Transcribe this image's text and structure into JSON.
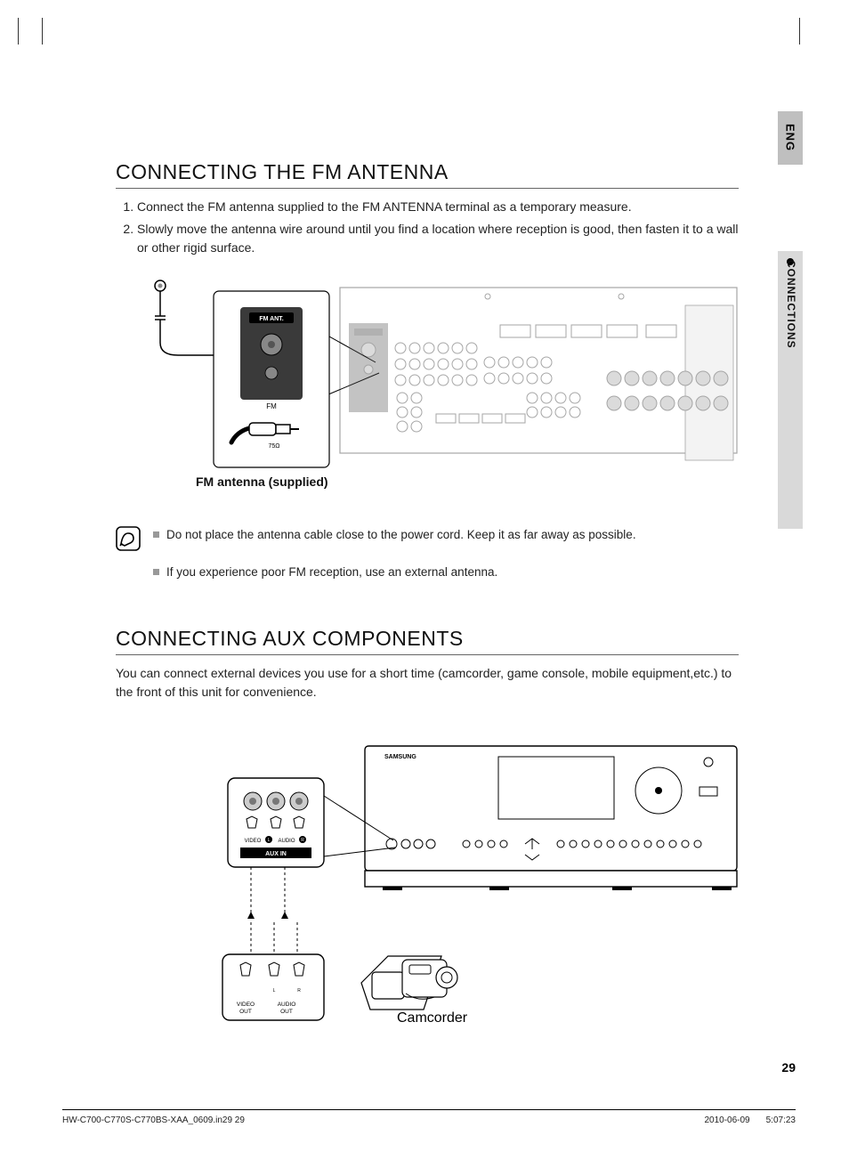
{
  "lang_tab": "ENG",
  "section_tab": "CONNECTIONS",
  "section1": {
    "title": "CONNECTING THE FM ANTENNA",
    "steps": [
      "Connect the FM antenna supplied to the FM ANTENNA terminal as a temporary measure.",
      "Slowly move the antenna wire around until you find a location where reception is good, then fasten it to a wall or other rigid surface."
    ],
    "fig_caption": "FM antenna (supplied)",
    "fig_label_fmant": "FM ANT.",
    "fig_label_fm": "FM",
    "fig_label_ohm": "75Ω",
    "notes": [
      "Do not place the antenna cable close to the power cord. Keep it as far away as possible.",
      "If you experience poor FM reception, use an external antenna."
    ]
  },
  "section2": {
    "title": "CONNECTING AUX COMPONENTS",
    "intro": "You can connect external devices you use for a short time (camcorder, game console, mobile equipment,etc.) to the front of this unit for convenience.",
    "fig_brand": "SAMSUNG",
    "fig_video": "VIDEO",
    "fig_audio": "AUDIO",
    "fig_auxin": "AUX IN",
    "fig_videoout": "VIDEO\nOUT",
    "fig_audioout": "AUDIO\nOUT",
    "fig_l": "L",
    "fig_r": "R",
    "fig_camcorder": "Camcorder"
  },
  "page_number": "29",
  "footer": {
    "left": "HW-C700-C770S-C770BS-XAA_0609.in29   29",
    "date": "2010-06-09",
    "time": "5:07:23"
  }
}
